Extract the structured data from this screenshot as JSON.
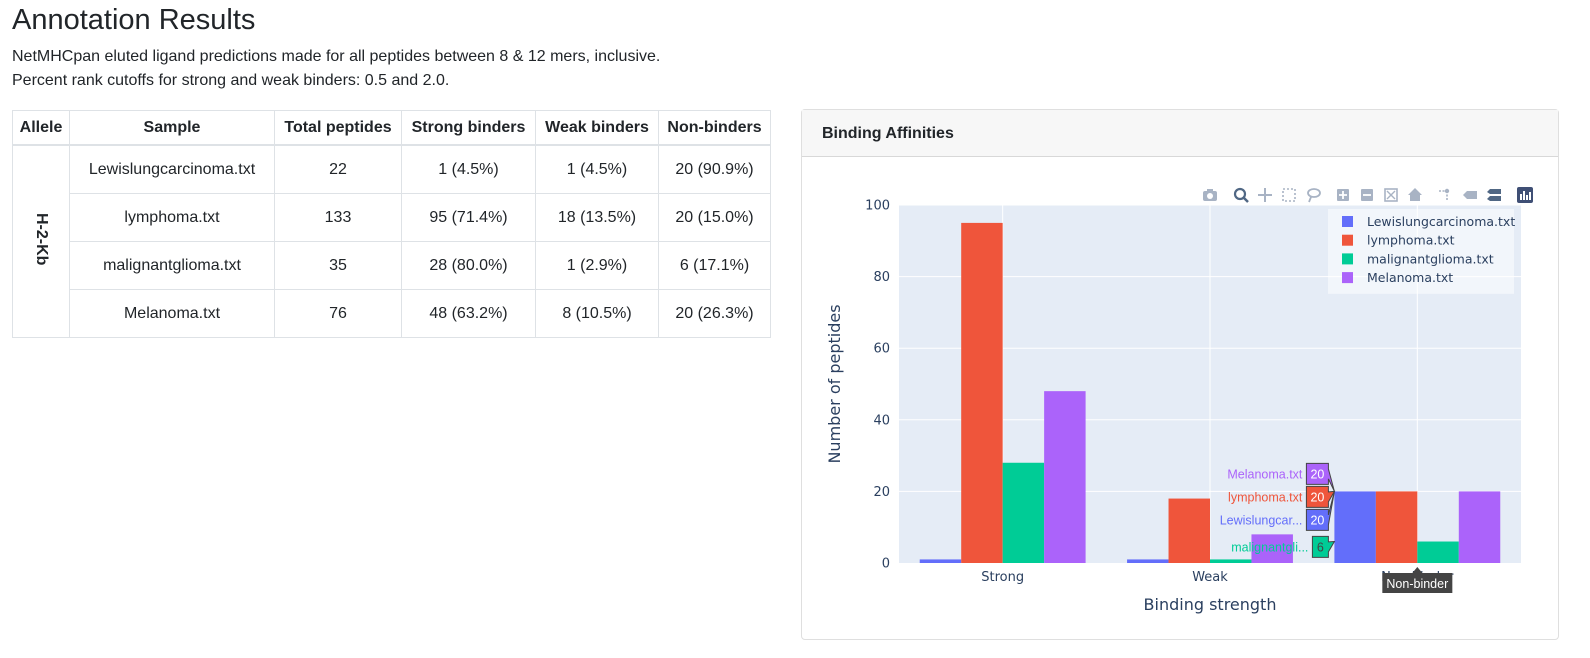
{
  "page": {
    "title": "Annotation Results",
    "description_1": "NetMHCpan eluted ligand predictions made for all peptides between 8 & 12 mers, inclusive.",
    "description_2": "Percent rank cutoffs for strong and weak binders: 0.5 and 2.0."
  },
  "table": {
    "headers": [
      "Allele",
      "Sample",
      "Total peptides",
      "Strong binders",
      "Weak binders",
      "Non-binders"
    ],
    "allele": "H-2-Kb",
    "rows": [
      {
        "sample": "Lewislungcarcinoma.txt",
        "total": "22",
        "strong": "1 (4.5%)",
        "weak": "1 (4.5%)",
        "non": "20 (90.9%)"
      },
      {
        "sample": "lymphoma.txt",
        "total": "133",
        "strong": "95 (71.4%)",
        "weak": "18 (13.5%)",
        "non": "20 (15.0%)"
      },
      {
        "sample": "malignantglioma.txt",
        "total": "35",
        "strong": "28 (80.0%)",
        "weak": "1 (2.9%)",
        "non": "6 (17.1%)"
      },
      {
        "sample": "Melanoma.txt",
        "total": "76",
        "strong": "48 (63.2%)",
        "weak": "8 (10.5%)",
        "non": "20 (26.3%)"
      }
    ]
  },
  "card": {
    "title": "Binding Affinities"
  },
  "modebar": {
    "icons": [
      "camera-icon",
      "zoom-icon",
      "pan-icon",
      "box-select-icon",
      "lasso-icon",
      "zoom-in-icon",
      "zoom-out-icon",
      "autoscale-icon",
      "reset-axes-icon",
      "spike-lines-icon",
      "hover-closest-icon",
      "hover-compare-icon",
      "plotly-logo-icon"
    ]
  },
  "chart_data": {
    "type": "bar",
    "categories": [
      "Strong",
      "Weak",
      "Non-binder"
    ],
    "series": [
      {
        "name": "Lewislungcarcinoma.txt",
        "values": [
          1,
          1,
          20
        ],
        "color": "#636efa"
      },
      {
        "name": "lymphoma.txt",
        "values": [
          95,
          18,
          20
        ],
        "color": "#ef553b"
      },
      {
        "name": "malignantglioma.txt",
        "values": [
          28,
          1,
          6
        ],
        "color": "#00cc96"
      },
      {
        "name": "Melanoma.txt",
        "values": [
          48,
          8,
          20
        ],
        "color": "#ab63fa"
      }
    ],
    "xlabel": "Binding strength",
    "ylabel": "Number of peptides",
    "ylim": [
      0,
      100
    ],
    "yticks": [
      0,
      20,
      40,
      60,
      80,
      100
    ],
    "grid": true,
    "legend_position": "top-right",
    "hover": {
      "category": "Non-binder",
      "labels": [
        {
          "series": "Melanoma.txt",
          "text": "Melanoma.txt",
          "value": "20"
        },
        {
          "series": "lymphoma.txt",
          "text": "lymphoma.txt",
          "value": "20"
        },
        {
          "series": "Lewislungcarcinoma.txt",
          "text": "Lewislungcar...",
          "value": "20"
        },
        {
          "series": "malignantglioma.txt",
          "text": "malignantgli...",
          "value": "6"
        }
      ]
    }
  }
}
